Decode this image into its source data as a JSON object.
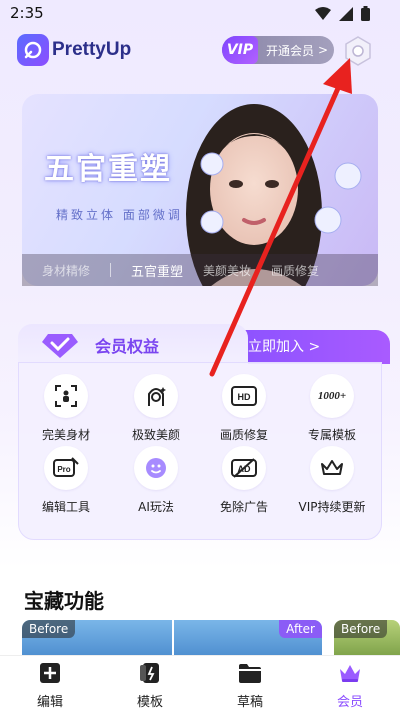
{
  "status_bar": {
    "time": "2:35"
  },
  "header": {
    "app_name": "PrettyUp",
    "vip_badge": "VIP",
    "vip_button_label": "开通会员",
    "vip_chevron": ">"
  },
  "banner": {
    "title": "五官重塑",
    "subtitle": "精致立体 面部微调",
    "tabs": [
      "身材精修",
      "五官重塑",
      "美颜美妆",
      "画质修复"
    ],
    "active_tab": "五官重塑"
  },
  "benefits": {
    "title": "会员权益",
    "join_button": "立即加入 >",
    "items": [
      {
        "label": "完美身材",
        "icon": "body-scan-icon"
      },
      {
        "label": "极致美颜",
        "icon": "face-beauty-icon"
      },
      {
        "label": "画质修复",
        "icon": "hd-icon"
      },
      {
        "label": "专属模板",
        "icon": "1000-plus-icon"
      },
      {
        "label": "编辑工具",
        "icon": "pro-edit-icon"
      },
      {
        "label": "AI玩法",
        "icon": "ai-face-icon"
      },
      {
        "label": "免除广告",
        "icon": "no-ad-icon"
      },
      {
        "label": "VIP持续更新",
        "icon": "crown-icon"
      }
    ],
    "hd_text": "HD",
    "templates_text": "1000+",
    "pro_text": "Pro",
    "ad_text": "AD"
  },
  "treasure": {
    "title": "宝藏功能",
    "labels": {
      "before1": "Before",
      "after1": "After",
      "before2": "Before"
    }
  },
  "bottom_nav": [
    {
      "label": "编辑",
      "icon": "plus-square-icon"
    },
    {
      "label": "模板",
      "icon": "template-icon"
    },
    {
      "label": "草稿",
      "icon": "folder-icon"
    },
    {
      "label": "会员",
      "icon": "crown-icon",
      "active": true
    }
  ],
  "colors": {
    "accent": "#8b4dff",
    "annotation_arrow": "#e8221f"
  }
}
